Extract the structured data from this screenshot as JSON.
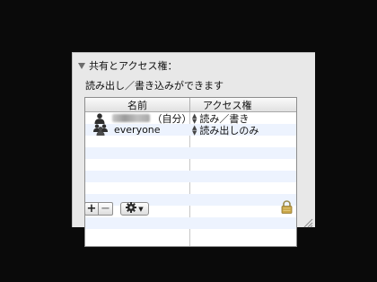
{
  "sharing": {
    "header": "共有とアクセス権：",
    "status": "読み出し／書き込みができます",
    "columns": {
      "name": "名前",
      "access": "アクセス権"
    },
    "rows": [
      {
        "suffix": "（自分）",
        "access": "読み／書き",
        "icon": "single-user-icon"
      },
      {
        "name": "everyone",
        "access": "読み出しのみ",
        "icon": "group-users-icon"
      }
    ]
  },
  "toolbar": {
    "add_label": "+",
    "remove_label": "−",
    "action_icon": "gear-icon"
  },
  "icons": {
    "lock": "lock-icon",
    "disclosure": "disclosure-triangle-icon"
  },
  "colors": {
    "stripe": "#edf3fe",
    "background": "#0a0a0a",
    "panel": "#e8e8e8"
  }
}
